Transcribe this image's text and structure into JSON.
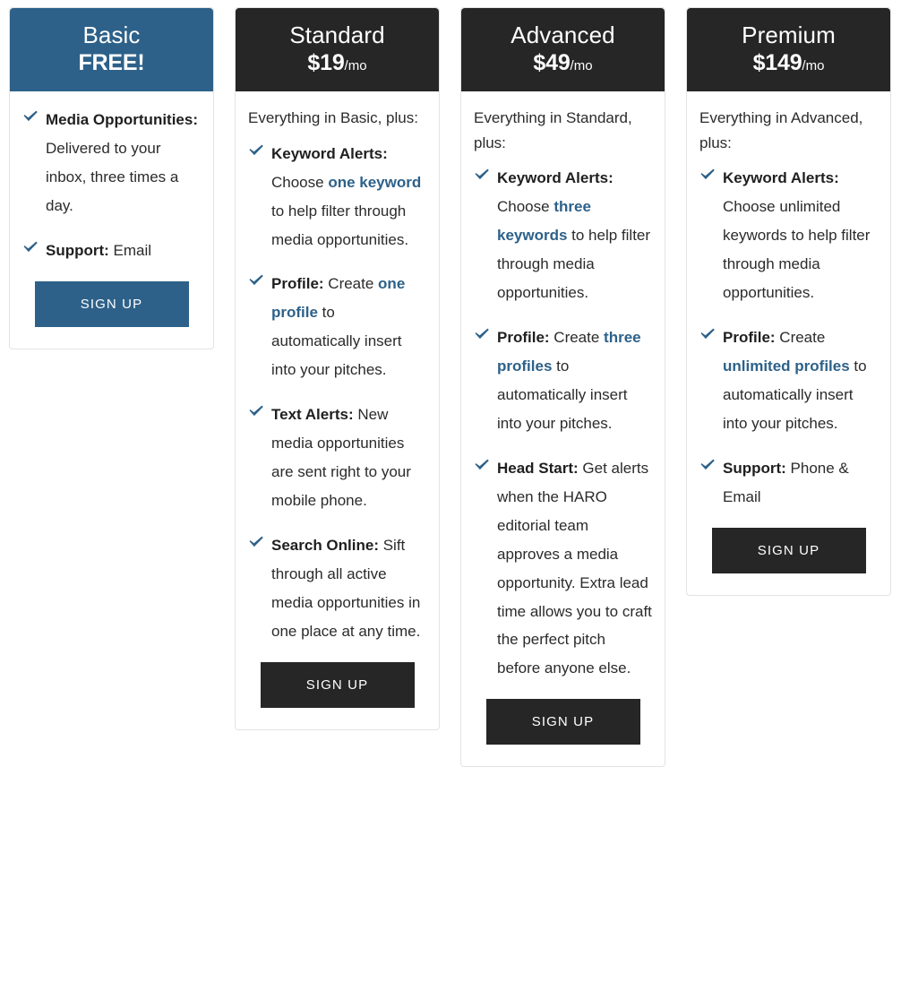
{
  "check_icon": "check-icon",
  "colors": {
    "accent": "#2d6189",
    "dark": "#262626",
    "text": "#2b2b2b",
    "border": "#e3e3e3"
  },
  "plans": [
    {
      "id": "basic",
      "name": "Basic",
      "price": "FREE!",
      "period": "",
      "theme": "accent",
      "intro": "",
      "features": [
        {
          "term": "Media Opportunities:",
          "rest_1": " Delivered to your inbox, three times a day.",
          "hl": "",
          "rest_2": ""
        },
        {
          "term": "Support:",
          "rest_1": " Email",
          "hl": "",
          "rest_2": ""
        }
      ],
      "signup_label": "SIGN UP"
    },
    {
      "id": "standard",
      "name": "Standard",
      "price": "$19",
      "period": "/mo",
      "theme": "dark",
      "intro": "Everything in Basic, plus:",
      "features": [
        {
          "term": "Keyword Alerts:",
          "rest_1": " Choose ",
          "hl": "one keyword",
          "rest_2": " to help filter through media opportunities."
        },
        {
          "term": "Profile:",
          "rest_1": " Create ",
          "hl": "one profile",
          "rest_2": " to automatically insert into your pitches."
        },
        {
          "term": "Text Alerts:",
          "rest_1": " New media opportunities are sent right to your mobile phone.",
          "hl": "",
          "rest_2": ""
        },
        {
          "term": "Search Online:",
          "rest_1": " Sift through all active media opportunities in one place at any time.",
          "hl": "",
          "rest_2": ""
        }
      ],
      "signup_label": "SIGN UP"
    },
    {
      "id": "advanced",
      "name": "Advanced",
      "price": "$49",
      "period": "/mo",
      "theme": "dark",
      "intro": "Everything in Standard, plus:",
      "features": [
        {
          "term": "Keyword Alerts:",
          "rest_1": " Choose ",
          "hl": "three keywords",
          "rest_2": " to help filter through media opportunities."
        },
        {
          "term": "Profile:",
          "rest_1": " Create ",
          "hl": "three profiles",
          "rest_2": " to automatically insert into your pitches."
        },
        {
          "term": "Head Start:",
          "rest_1": " Get alerts when the HARO editorial team approves a media opportunity. Extra lead time allows you to craft the perfect pitch before anyone else.",
          "hl": "",
          "rest_2": ""
        }
      ],
      "signup_label": "SIGN UP"
    },
    {
      "id": "premium",
      "name": "Premium",
      "price": "$149",
      "period": "/mo",
      "theme": "dark",
      "intro": "Everything in Advanced, plus:",
      "features": [
        {
          "term": "Keyword Alerts:",
          "rest_1": " Choose unlimited keywords to help filter through media opportunities.",
          "hl": "",
          "rest_2": ""
        },
        {
          "term": "Profile:",
          "rest_1": " Create ",
          "hl": "unlimited profiles",
          "rest_2": " to automatically insert into your pitches."
        },
        {
          "term": "Support:",
          "rest_1": " Phone & Email",
          "hl": "",
          "rest_2": ""
        }
      ],
      "signup_label": "SIGN UP"
    }
  ]
}
